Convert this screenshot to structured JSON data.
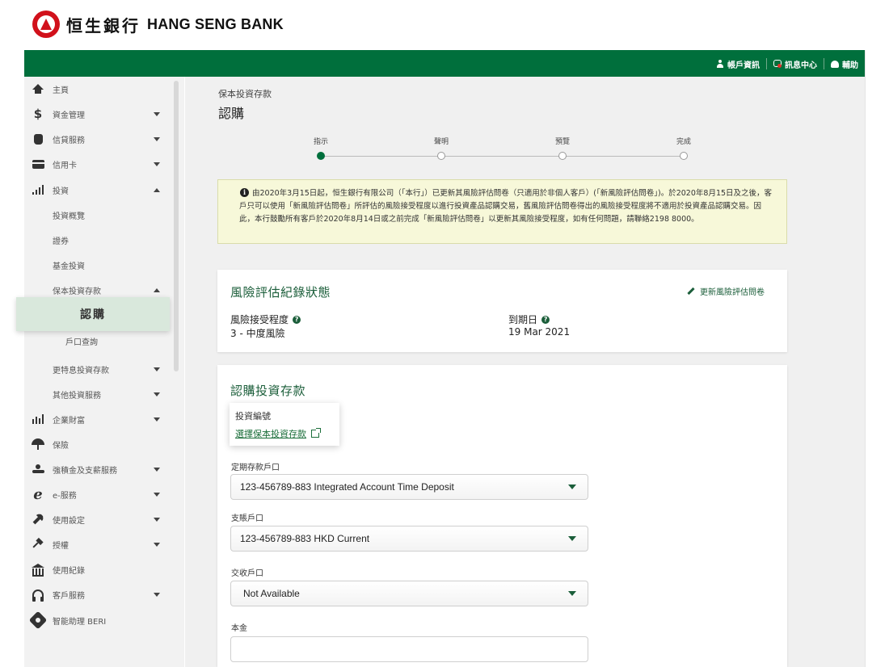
{
  "header": {
    "logo_zh": "恒生銀行",
    "logo_en": "HANG SENG BANK",
    "links": [
      {
        "label": "帳戶資訊",
        "icon": "user-icon"
      },
      {
        "label": "訊息中心",
        "icon": "message-icon"
      },
      {
        "label": "輔助",
        "icon": "help-icon"
      }
    ]
  },
  "sidebar": {
    "items": [
      {
        "label": "主頁",
        "icon": "home-icon"
      },
      {
        "label": "資金管理",
        "icon": "dollar-icon"
      },
      {
        "label": "信貸服務",
        "icon": "money-bag-icon"
      },
      {
        "label": "信用卡",
        "icon": "credit-card-icon"
      },
      {
        "label": "投資",
        "icon": "bar-chart-icon"
      },
      {
        "label": "投資概覽"
      },
      {
        "label": "證券"
      },
      {
        "label": "基金投資"
      },
      {
        "label": "保本投資存款"
      },
      {
        "label": "認購"
      },
      {
        "label": "戶口查詢"
      },
      {
        "label": "更特息投資存款"
      },
      {
        "label": "其他投資服務"
      },
      {
        "label": "企業財富",
        "icon": "growth-chart-icon"
      },
      {
        "label": "保險",
        "icon": "umbrella-icon"
      },
      {
        "label": "強積金及支薪服務",
        "icon": "hand-coin-icon"
      },
      {
        "label": "e-服務",
        "icon": "e-icon"
      },
      {
        "label": "使用設定",
        "icon": "wrench-icon"
      },
      {
        "label": "授權",
        "icon": "gavel-icon"
      },
      {
        "label": "使用紀錄",
        "icon": "bank-building-icon"
      },
      {
        "label": "客戶服務",
        "icon": "headset-icon"
      },
      {
        "label": "智能助理 BERI",
        "icon": "beri-icon"
      }
    ]
  },
  "page": {
    "breadcrumb": "保本投資存款",
    "title": "認購"
  },
  "stepper": {
    "steps": [
      "指示",
      "聲明",
      "預覽",
      "完成"
    ],
    "active_index": 0
  },
  "notice": {
    "text": "由2020年3月15日起，恒生銀行有限公司（「本行」）已更新其風險評估問卷（只適用於非個人客戶）(「新風險評估問卷」)。於2020年8月15日及之後，客戶只可以使用「新風險評估問卷」所評估的風險接受程度以進行投資產品認購交易，舊風險評估問卷得出的風險接受程度將不適用於投資產品認購交易。因此，本行鼓勵所有客戶於2020年8月14日或之前完成「新風險評估問卷」以更新其風險接受程度，如有任何問題，請聯絡2198 8000。"
  },
  "risk_card": {
    "title": "風險評估紀錄狀態",
    "edit_link": "更新風險評估問卷",
    "risk_label": "風險接受程度",
    "risk_value": "3 - 中度風險",
    "expiry_label": "到期日",
    "expiry_value": "19 Mar 2021"
  },
  "subscribe_card": {
    "title": "認購投資存款",
    "invest_code_label": "投資編號",
    "invest_code_link": "選擇保本投資存款",
    "time_deposit_label": "定期存款戶口",
    "time_deposit_value": "123-456789-883  Integrated Account Time Deposit",
    "debit_label": "支賬戶口",
    "debit_value": "123-456789-883  HKD Current",
    "settlement_label": "交收戶口",
    "settlement_value": "Not Available",
    "principal_label": "本金",
    "principal_value": ""
  },
  "colors": {
    "brand_green": "#006f3c",
    "brand_red": "#d1111b",
    "notice_bg": "#f7f8d9"
  }
}
